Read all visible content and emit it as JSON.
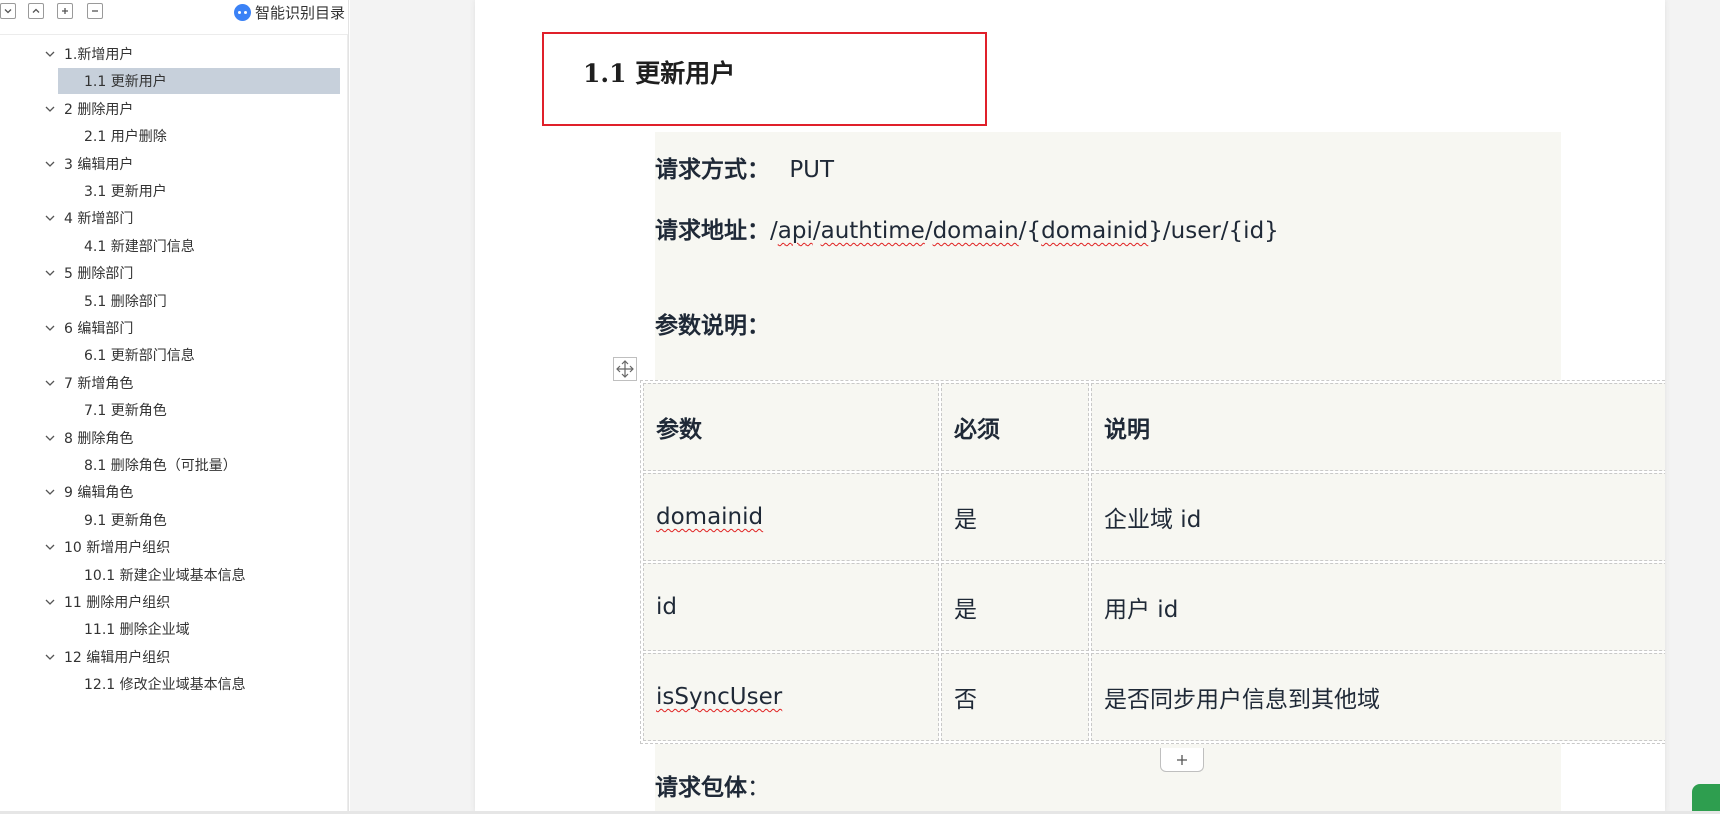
{
  "toolbar": {
    "smart_toc_label": "智能识别目录",
    "buttons": [
      "expand-all",
      "collapse-all",
      "add",
      "remove"
    ]
  },
  "toc": {
    "selected_index": 1,
    "items": [
      {
        "label": "1.新增用户",
        "level": 1
      },
      {
        "label": "1.1 更新用户",
        "level": 2
      },
      {
        "label": "2 删除用户",
        "level": 1
      },
      {
        "label": "2.1 用户删除",
        "level": 2
      },
      {
        "label": "3 编辑用户",
        "level": 1
      },
      {
        "label": "3.1 更新用户",
        "level": 2
      },
      {
        "label": "4 新增部门",
        "level": 1
      },
      {
        "label": "4.1 新建部门信息",
        "level": 2
      },
      {
        "label": "5 删除部门",
        "level": 1
      },
      {
        "label": "5.1 删除部门",
        "level": 2
      },
      {
        "label": "6 编辑部门",
        "level": 1
      },
      {
        "label": "6.1 更新部门信息",
        "level": 2
      },
      {
        "label": "7 新增角色",
        "level": 1
      },
      {
        "label": "7.1 更新角色",
        "level": 2
      },
      {
        "label": "8 删除角色",
        "level": 1
      },
      {
        "label": "8.1 删除角色（可批量）",
        "level": 2
      },
      {
        "label": "9 编辑角色",
        "level": 1
      },
      {
        "label": "9.1 更新角色",
        "level": 2
      },
      {
        "label": "10 新增用户组织",
        "level": 1
      },
      {
        "label": "10.1 新建企业域基本信息",
        "level": 2
      },
      {
        "label": "11 删除用户组织",
        "level": 1
      },
      {
        "label": "11.1 删除企业域",
        "level": 2
      },
      {
        "label": "12 编辑用户组织",
        "level": 1
      },
      {
        "label": "12.1 修改企业域基本信息",
        "level": 2
      }
    ]
  },
  "doc": {
    "heading": "1.1 更新用户",
    "method_label": "请求方式：",
    "method_value": "PUT",
    "url_label": "请求地址：",
    "url_parts": [
      "/",
      "api",
      "/",
      "authtime",
      "/",
      "domain",
      "/{",
      "domainid",
      "}/user/{id}"
    ],
    "params_label": "参数说明：",
    "body_label": "请求包体",
    "body_colon": "："
  },
  "table": {
    "headers": [
      "参数",
      "必须",
      "说明"
    ],
    "rows": [
      [
        "domainid",
        "是",
        "企业域 id"
      ],
      [
        "id",
        "是",
        "用户 id"
      ],
      [
        "isSyncUser",
        "否",
        "是否同步用户信息到其他域"
      ]
    ],
    "misspelled": [
      "domainid",
      "isSyncUser"
    ]
  },
  "colors": {
    "heading_border": "#e0202a",
    "selected_bg": "#c7d0db",
    "content_bg": "#f7f7f2",
    "spellcheck": "#e02020"
  }
}
